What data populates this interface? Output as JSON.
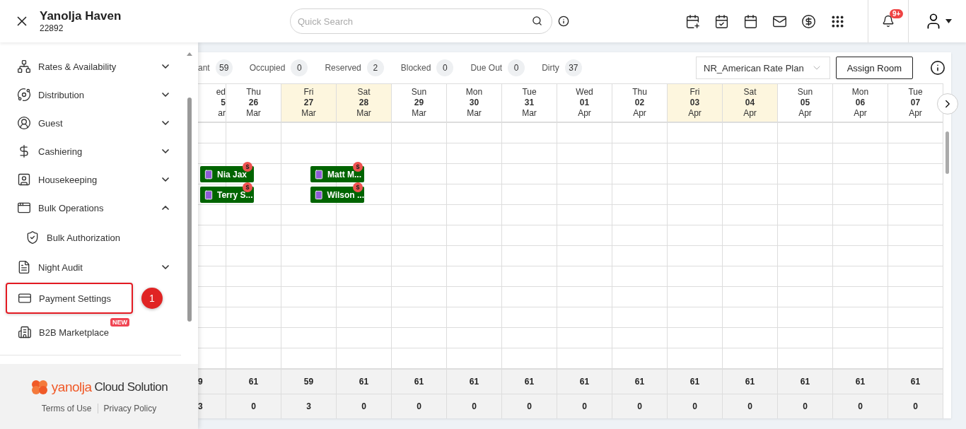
{
  "header": {
    "property_name": "Yanolja Haven",
    "property_id": "22892",
    "search": {
      "placeholder": "Quick Search"
    },
    "notifications_badge": "9+"
  },
  "sidebar": {
    "items": [
      {
        "label": "Rates & Availability",
        "kind": "group",
        "expanded": false
      },
      {
        "label": "Distribution",
        "kind": "group",
        "expanded": false
      },
      {
        "label": "Guest",
        "kind": "group",
        "expanded": false
      },
      {
        "label": "Cashiering",
        "kind": "group",
        "expanded": false
      },
      {
        "label": "Housekeeping",
        "kind": "group",
        "expanded": false
      },
      {
        "label": "Bulk Operations",
        "kind": "group",
        "expanded": true,
        "children": [
          {
            "label": "Bulk Authorization"
          }
        ]
      },
      {
        "label": "Night Audit",
        "kind": "group",
        "expanded": false
      },
      {
        "label": "Payment Settings",
        "kind": "link",
        "highlighted": true,
        "callout": "1"
      },
      {
        "label": "B2B Marketplace",
        "kind": "link",
        "highlighted": false,
        "badge": "NEW"
      }
    ],
    "footer": {
      "brand_main": "yanolja",
      "brand_sub": "Cloud Solution",
      "links": [
        "Terms of Use",
        "Privacy Policy"
      ]
    }
  },
  "stats": [
    {
      "label": "ant",
      "count": "59"
    },
    {
      "label": "Occupied",
      "count": "0"
    },
    {
      "label": "Reserved",
      "count": "2"
    },
    {
      "label": "Blocked",
      "count": "0"
    },
    {
      "label": "Due Out",
      "count": "0"
    },
    {
      "label": "Dirty",
      "count": "37"
    }
  ],
  "rate_plan": {
    "value": "NR_American Rate Plan"
  },
  "assign_button": "Assign Room",
  "days": [
    {
      "weekday": "ed",
      "day": "5",
      "month": "ar",
      "weekend": false
    },
    {
      "weekday": "Thu",
      "day": "26",
      "month": "Mar",
      "weekend": false
    },
    {
      "weekday": "Fri",
      "day": "27",
      "month": "Mar",
      "weekend": true
    },
    {
      "weekday": "Sat",
      "day": "28",
      "month": "Mar",
      "weekend": true
    },
    {
      "weekday": "Sun",
      "day": "29",
      "month": "Mar",
      "weekend": false
    },
    {
      "weekday": "Mon",
      "day": "30",
      "month": "Mar",
      "weekend": false
    },
    {
      "weekday": "Tue",
      "day": "31",
      "month": "Mar",
      "weekend": false
    },
    {
      "weekday": "Wed",
      "day": "01",
      "month": "Apr",
      "weekend": false
    },
    {
      "weekday": "Thu",
      "day": "02",
      "month": "Apr",
      "weekend": false
    },
    {
      "weekday": "Fri",
      "day": "03",
      "month": "Apr",
      "weekend": true
    },
    {
      "weekday": "Sat",
      "day": "04",
      "month": "Apr",
      "weekend": true
    },
    {
      "weekday": "Sun",
      "day": "05",
      "month": "Apr",
      "weekend": false
    },
    {
      "weekday": "Mon",
      "day": "06",
      "month": "Apr",
      "weekend": false
    },
    {
      "weekday": "Tue",
      "day": "07",
      "month": "Apr",
      "weekend": false
    }
  ],
  "bookings": [
    {
      "guest": "Nia Jax",
      "balance_badge": "$"
    },
    {
      "guest": "Terry S...",
      "balance_badge": "$"
    },
    {
      "guest": "Matt M...",
      "balance_badge": "$"
    },
    {
      "guest": "Wilson ...",
      "balance_badge": "$"
    }
  ],
  "totals": [
    [
      "9",
      "61",
      "59",
      "61",
      "61",
      "61",
      "61",
      "61",
      "61",
      "61",
      "61",
      "61",
      "61",
      "61"
    ],
    [
      "3",
      "0",
      "3",
      "0",
      "0",
      "0",
      "0",
      "0",
      "0",
      "0",
      "0",
      "0",
      "0",
      "0"
    ]
  ]
}
